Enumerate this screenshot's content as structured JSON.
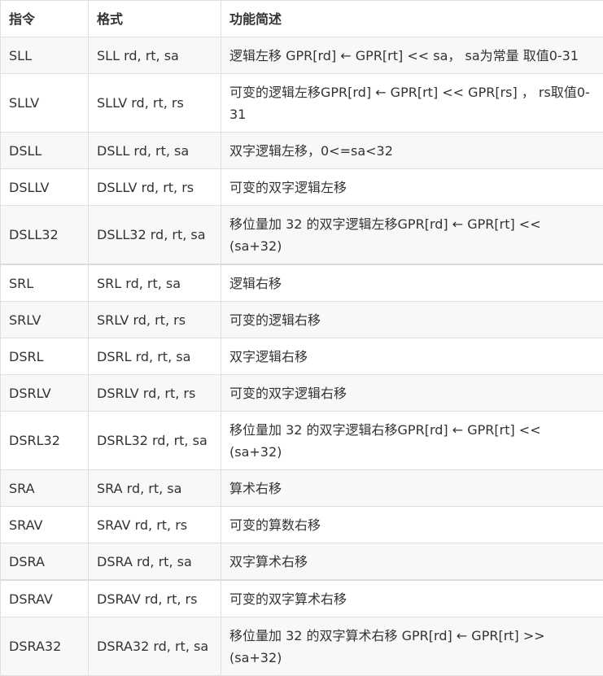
{
  "table": {
    "headers": [
      "指令",
      "格式",
      "功能简述"
    ],
    "rows": [
      {
        "instr": "SLL",
        "format": "SLL rd, rt, sa",
        "desc": "逻辑左移 GPR[rd] ← GPR[rt] << sa， sa为常量 取值0-31"
      },
      {
        "instr": "SLLV",
        "format": "SLLV rd, rt, rs",
        "desc": "可变的逻辑左移GPR[rd] ← GPR[rt] << GPR[rs] ， rs取值0-31"
      },
      {
        "instr": "DSLL",
        "format": "DSLL rd, rt, sa",
        "desc": " 双字逻辑左移，0<=sa<32"
      },
      {
        "instr": "DSLLV",
        "format": "DSLLV rd, rt, rs",
        "desc": " 可变的双字逻辑左移"
      },
      {
        "instr": "DSLL32",
        "format": "DSLL32 rd, rt, sa",
        "desc": " 移位量加 32 的双字逻辑左移GPR[rd] ← GPR[rt] << (sa+32)"
      },
      {
        "instr": "SRL",
        "format": "SRL rd, rt, sa",
        "desc": "逻辑右移"
      },
      {
        "instr": "SRLV",
        "format": "SRLV rd, rt, rs",
        "desc": "可变的逻辑右移"
      },
      {
        "instr": "DSRL",
        "format": "DSRL rd, rt, sa",
        "desc": "双字逻辑右移"
      },
      {
        "instr": "DSRLV",
        "format": "DSRLV rd, rt, rs",
        "desc": "可变的双字逻辑右移"
      },
      {
        "instr": "DSRL32",
        "format": "DSRL32 rd, rt, sa",
        "desc": "移位量加 32 的双字逻辑右移GPR[rd] ← GPR[rt] << (sa+32)"
      },
      {
        "instr": "SRA",
        "format": "SRA rd, rt, sa",
        "desc": "算术右移"
      },
      {
        "instr": "SRAV",
        "format": "SRAV rd, rt, rs",
        "desc": "可变的算数右移"
      },
      {
        "instr": "DSRA",
        "format": "DSRA rd, rt, sa",
        "desc": "双字算术右移"
      },
      {
        "instr": "DSRAV",
        "format": "DSRAV rd, rt, rs",
        "desc": "可变的双字算术右移"
      },
      {
        "instr": "DSRA32",
        "format": "DSRA32 rd, rt, sa",
        "desc": "移位量加 32 的双字算术右移 GPR[rd] ← GPR[rt] >> (sa+32)"
      }
    ]
  }
}
